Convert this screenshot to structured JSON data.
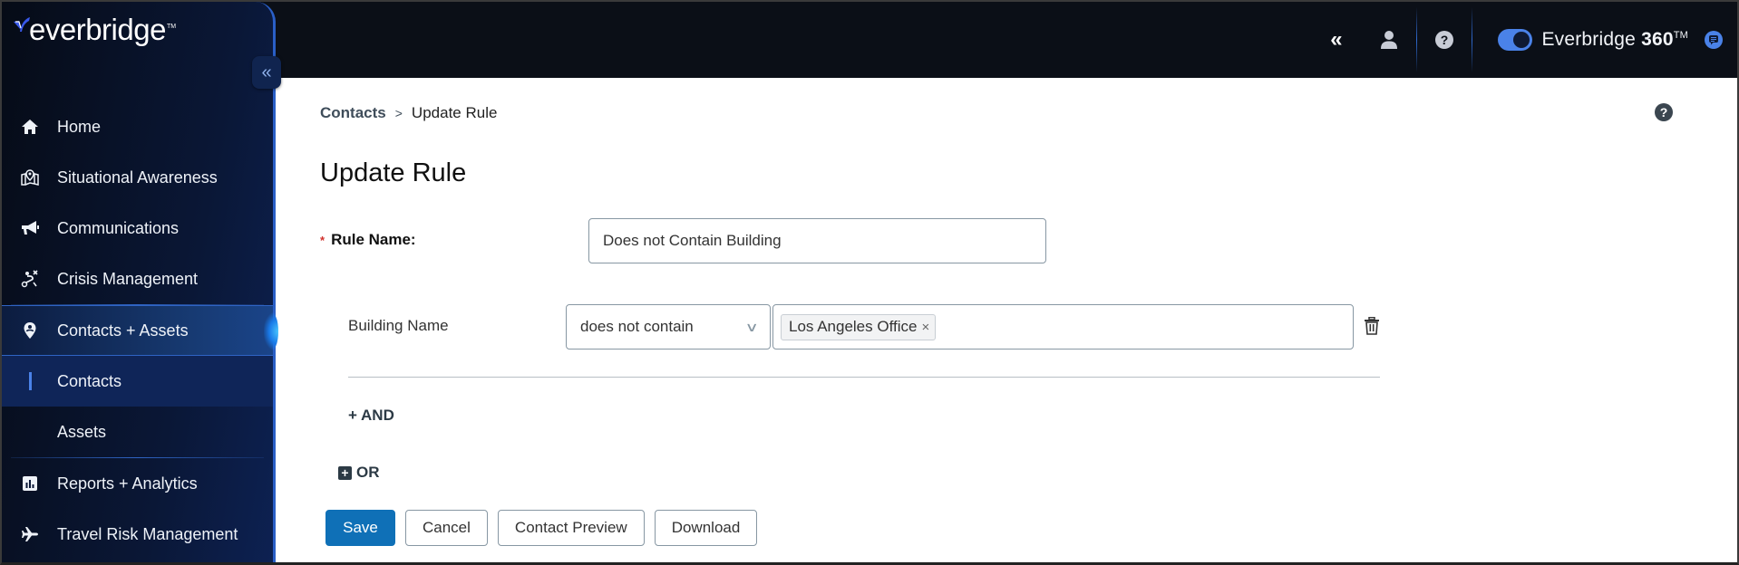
{
  "header": {
    "collapse_label": "Collapse",
    "product_name": "Everbridge",
    "product_suffix": "360",
    "trademark": "TM",
    "toggle_on": true
  },
  "sidebar": {
    "logo_text": "everbridge",
    "logo_tm": "TM",
    "items": [
      {
        "label": "Home",
        "icon": "home-icon"
      },
      {
        "label": "Situational Awareness",
        "icon": "map-pin-icon"
      },
      {
        "label": "Communications",
        "icon": "megaphone-icon"
      },
      {
        "label": "Crisis Management",
        "icon": "route-icon"
      },
      {
        "label": "Contacts + Assets",
        "icon": "location-person-icon",
        "active": true
      },
      {
        "label": "Reports + Analytics",
        "icon": "bar-chart-icon"
      },
      {
        "label": "Travel Risk Management",
        "icon": "airplane-icon"
      }
    ],
    "subitems": [
      {
        "label": "Contacts",
        "current": true
      },
      {
        "label": "Assets"
      }
    ]
  },
  "breadcrumb": {
    "parent": "Contacts",
    "separator": ">",
    "current": "Update Rule"
  },
  "page": {
    "title": "Update Rule"
  },
  "form": {
    "rule_name_label": "Rule Name:",
    "required_marker": "*",
    "rule_name_value": "Does not Contain Building",
    "condition": {
      "field_label": "Building Name",
      "operator": "does not contain",
      "values": [
        "Los Angeles Office"
      ],
      "remove_tag_symbol": "×"
    },
    "and_label": "+ AND",
    "or_label": "OR",
    "or_plus": "+"
  },
  "buttons": {
    "save": "Save",
    "cancel": "Cancel",
    "contact_preview": "Contact Preview",
    "download": "Download"
  },
  "colors": {
    "primary": "#0f70b7",
    "accent": "#4a82e8",
    "header_bg": "#0b0f17",
    "required": "#d0302b"
  }
}
